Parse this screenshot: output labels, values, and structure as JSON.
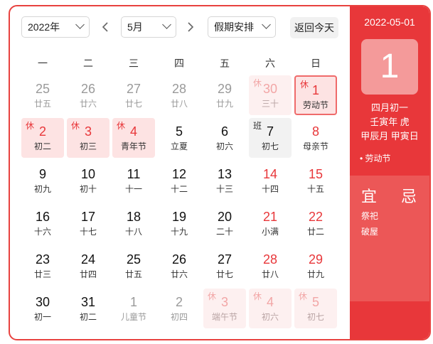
{
  "toolbar": {
    "year_select": "2022年",
    "month_select": "5月",
    "holiday_select": "假期安排",
    "today_button": "返回今天"
  },
  "weekdays": [
    "一",
    "二",
    "三",
    "四",
    "五",
    "六",
    "日"
  ],
  "days": [
    {
      "n": "25",
      "l": "廿五",
      "cls": "other"
    },
    {
      "n": "26",
      "l": "廿六",
      "cls": "other"
    },
    {
      "n": "27",
      "l": "廿七",
      "cls": "other"
    },
    {
      "n": "28",
      "l": "廿八",
      "cls": "other"
    },
    {
      "n": "29",
      "l": "廿九",
      "cls": "other"
    },
    {
      "n": "30",
      "l": "三十",
      "cls": "other holiday",
      "tag": "休"
    },
    {
      "n": "1",
      "l": "劳动节",
      "cls": "holiday selected",
      "tag": "休"
    },
    {
      "n": "2",
      "l": "初二",
      "cls": "holiday",
      "tag": "休"
    },
    {
      "n": "3",
      "l": "初三",
      "cls": "holiday",
      "tag": "休"
    },
    {
      "n": "4",
      "l": "青年节",
      "cls": "holiday",
      "tag": "休"
    },
    {
      "n": "5",
      "l": "立夏",
      "cls": ""
    },
    {
      "n": "6",
      "l": "初六",
      "cls": ""
    },
    {
      "n": "7",
      "l": "初七",
      "cls": "work",
      "tag": "班"
    },
    {
      "n": "8",
      "l": "母亲节",
      "cls": "weekend"
    },
    {
      "n": "9",
      "l": "初九",
      "cls": ""
    },
    {
      "n": "10",
      "l": "初十",
      "cls": ""
    },
    {
      "n": "11",
      "l": "十一",
      "cls": ""
    },
    {
      "n": "12",
      "l": "十二",
      "cls": ""
    },
    {
      "n": "13",
      "l": "十三",
      "cls": ""
    },
    {
      "n": "14",
      "l": "十四",
      "cls": "weekend"
    },
    {
      "n": "15",
      "l": "十五",
      "cls": "weekend"
    },
    {
      "n": "16",
      "l": "十六",
      "cls": ""
    },
    {
      "n": "17",
      "l": "十七",
      "cls": ""
    },
    {
      "n": "18",
      "l": "十八",
      "cls": ""
    },
    {
      "n": "19",
      "l": "十九",
      "cls": ""
    },
    {
      "n": "20",
      "l": "二十",
      "cls": ""
    },
    {
      "n": "21",
      "l": "小满",
      "cls": "weekend"
    },
    {
      "n": "22",
      "l": "廿二",
      "cls": "weekend"
    },
    {
      "n": "23",
      "l": "廿三",
      "cls": ""
    },
    {
      "n": "24",
      "l": "廿四",
      "cls": ""
    },
    {
      "n": "25",
      "l": "廿五",
      "cls": ""
    },
    {
      "n": "26",
      "l": "廿六",
      "cls": ""
    },
    {
      "n": "27",
      "l": "廿七",
      "cls": ""
    },
    {
      "n": "28",
      "l": "廿八",
      "cls": "weekend"
    },
    {
      "n": "29",
      "l": "廿九",
      "cls": "weekend"
    },
    {
      "n": "30",
      "l": "初一",
      "cls": ""
    },
    {
      "n": "31",
      "l": "初二",
      "cls": ""
    },
    {
      "n": "1",
      "l": "儿童节",
      "cls": "other"
    },
    {
      "n": "2",
      "l": "初四",
      "cls": "other"
    },
    {
      "n": "3",
      "l": "端午节",
      "cls": "other holiday",
      "tag": "休"
    },
    {
      "n": "4",
      "l": "初六",
      "cls": "other holiday",
      "tag": "休"
    },
    {
      "n": "5",
      "l": "初七",
      "cls": "other holiday",
      "tag": "休"
    }
  ],
  "panel": {
    "date": "2022-05-01",
    "day": "1",
    "lunar": "四月初一",
    "year_gz": "壬寅年 虎",
    "month_day_gz": "甲辰月 甲寅日",
    "festival": "• 劳动节",
    "yi": "宜",
    "ji": "忌",
    "yi_items": [
      "祭祀",
      "破屋"
    ]
  },
  "colors": {
    "accent": "#e8373a",
    "holiday_bg": "#fde3e3",
    "work_bg": "#f2f2f2"
  }
}
